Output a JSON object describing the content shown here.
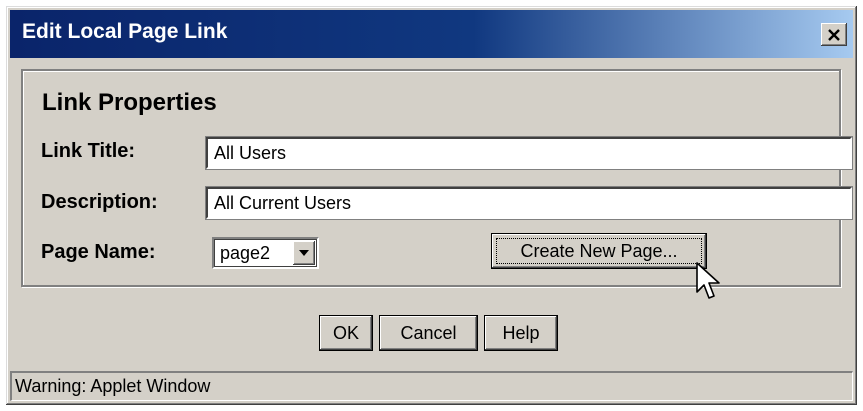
{
  "window": {
    "title": "Edit Local Page Link",
    "title_bar_color": "#0a246a",
    "face_color": "#d4d0c8"
  },
  "panel": {
    "heading": "Link Properties",
    "fields": {
      "link_title": {
        "label": "Link Title:",
        "value": "All Users"
      },
      "description": {
        "label": "Description:",
        "value": "All Current Users"
      },
      "page_name": {
        "label": "Page Name:",
        "selected": "page2"
      }
    },
    "create_button": "Create New Page..."
  },
  "buttons": {
    "ok": "OK",
    "cancel": "Cancel",
    "help": "Help"
  },
  "status": {
    "text": "Warning: Applet Window"
  },
  "icons": {
    "close": "close-icon",
    "dropdown": "chevron-down-icon",
    "cursor": "mouse-pointer-icon"
  }
}
